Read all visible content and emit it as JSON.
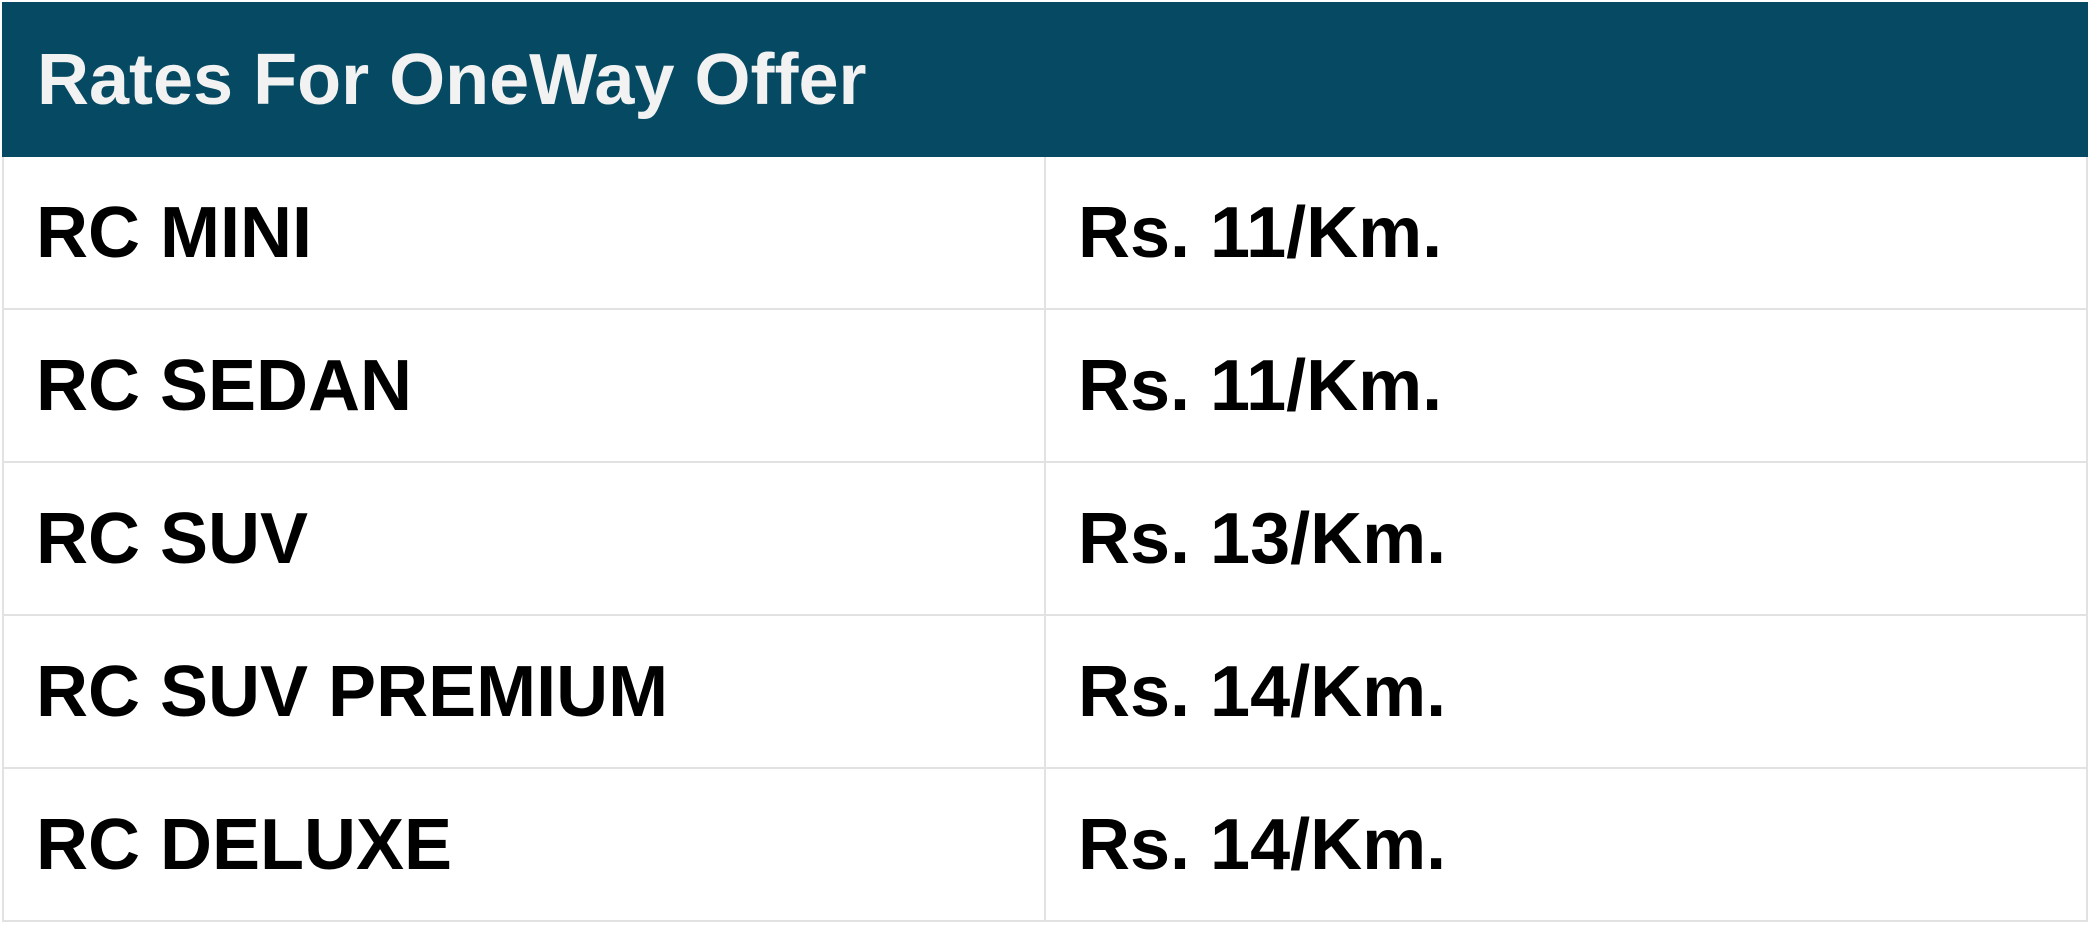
{
  "table": {
    "title": "Rates For OneWay Offer",
    "header_bg": "#054a62",
    "rows": [
      {
        "car": "RC MINI",
        "rate": "Rs. 11/Km."
      },
      {
        "car": "RC SEDAN",
        "rate": "Rs. 11/Km."
      },
      {
        "car": "RC SUV",
        "rate": "Rs. 13/Km."
      },
      {
        "car": "RC SUV PREMIUM",
        "rate": "Rs. 14/Km."
      },
      {
        "car": "RC DELUXE",
        "rate": "Rs. 14/Km."
      }
    ]
  }
}
